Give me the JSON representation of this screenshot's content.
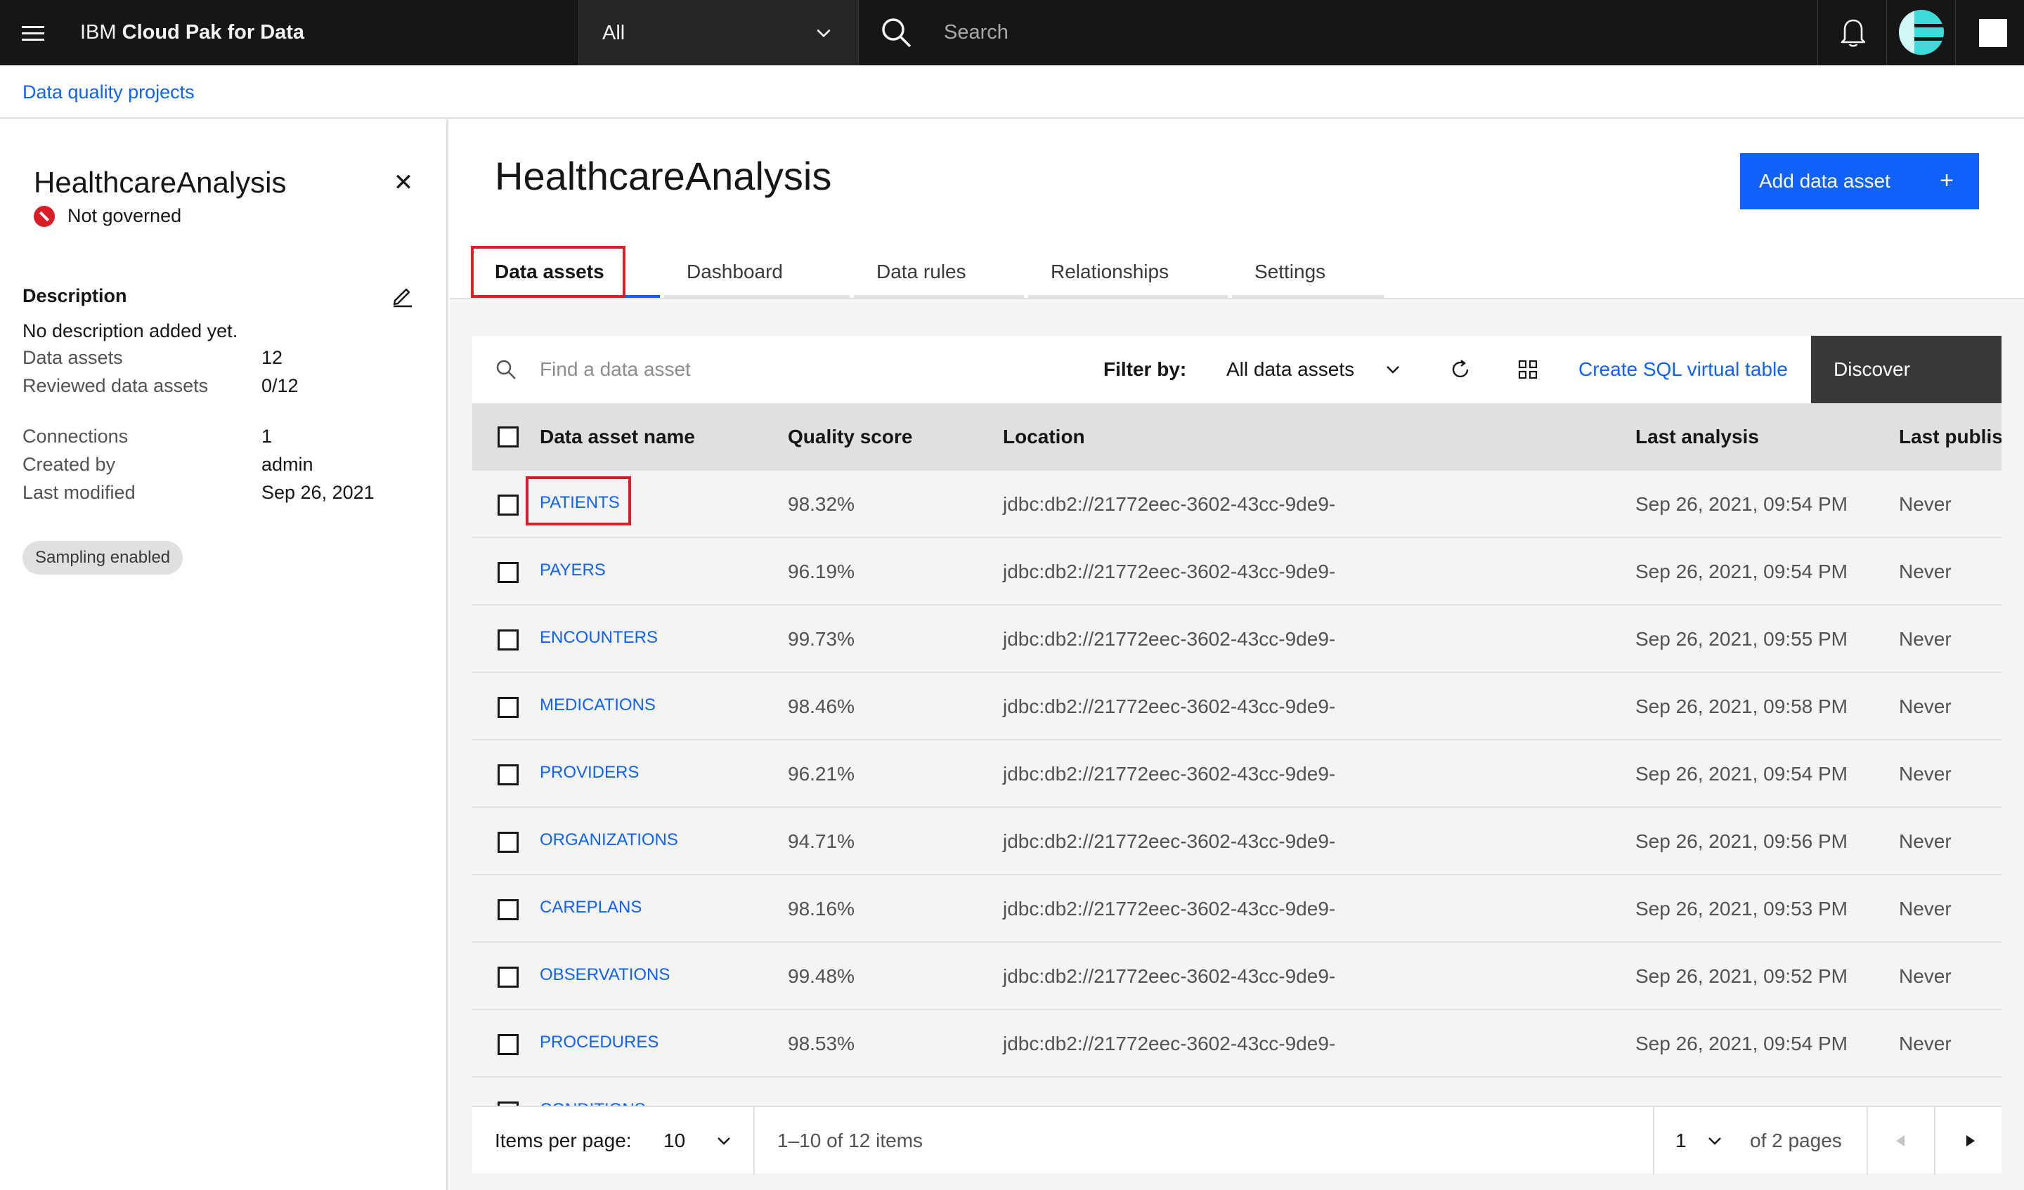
{
  "header": {
    "menu_icon": "hamburger-menu-icon",
    "brand_prefix": "IBM ",
    "brand_name": "Cloud Pak for Data",
    "scope_value": "All",
    "search_placeholder": "Search",
    "notification_icon": "bell-icon",
    "avatar_icon": "user-avatar-icon"
  },
  "breadcrumb": {
    "label": "Data quality projects"
  },
  "side_panel": {
    "title": "HealthcareAnalysis",
    "close_icon": "close-icon",
    "status": "Not governed",
    "description_heading": "Description",
    "description": "No description added yet.",
    "meta": [
      {
        "label": "Data assets",
        "value": "12"
      },
      {
        "label": "Reviewed data assets",
        "value": "0/12"
      },
      {
        "label": "Connections",
        "value": "1"
      },
      {
        "label": "Created by",
        "value": "admin"
      },
      {
        "label": "Last modified",
        "value": "Sep 26, 2021"
      }
    ],
    "tag": "Sampling enabled"
  },
  "main": {
    "title": "HealthcareAnalysis",
    "add_button": "Add data asset",
    "add_icon": "+",
    "tabs": [
      {
        "label": "Data assets",
        "active": true
      },
      {
        "label": "Dashboard",
        "active": false
      },
      {
        "label": "Data rules",
        "active": false
      },
      {
        "label": "Relationships",
        "active": false
      },
      {
        "label": "Settings",
        "active": false
      }
    ]
  },
  "toolbar": {
    "search_placeholder": "Find a data asset",
    "filter_label": "Filter by:",
    "filter_value": "All data assets",
    "create_sql": "Create SQL virtual table",
    "discover": "Discover"
  },
  "table": {
    "columns": [
      "Data asset name",
      "Quality score",
      "Location",
      "Last analysis",
      "Last publisl"
    ],
    "rows": [
      {
        "name": "PATIENTS",
        "score": "98.32%",
        "location": "jdbc:db2://21772eec-3602-43cc-9de9-",
        "last_analysis": "Sep 26, 2021, 09:54 PM",
        "last_published": "Never"
      },
      {
        "name": "PAYERS",
        "score": "96.19%",
        "location": "jdbc:db2://21772eec-3602-43cc-9de9-",
        "last_analysis": "Sep 26, 2021, 09:54 PM",
        "last_published": "Never"
      },
      {
        "name": "ENCOUNTERS",
        "score": "99.73%",
        "location": "jdbc:db2://21772eec-3602-43cc-9de9-",
        "last_analysis": "Sep 26, 2021, 09:55 PM",
        "last_published": "Never"
      },
      {
        "name": "MEDICATIONS",
        "score": "98.46%",
        "location": "jdbc:db2://21772eec-3602-43cc-9de9-",
        "last_analysis": "Sep 26, 2021, 09:58 PM",
        "last_published": "Never"
      },
      {
        "name": "PROVIDERS",
        "score": "96.21%",
        "location": "jdbc:db2://21772eec-3602-43cc-9de9-",
        "last_analysis": "Sep 26, 2021, 09:54 PM",
        "last_published": "Never"
      },
      {
        "name": "ORGANIZATIONS",
        "score": "94.71%",
        "location": "jdbc:db2://21772eec-3602-43cc-9de9-",
        "last_analysis": "Sep 26, 2021, 09:56 PM",
        "last_published": "Never"
      },
      {
        "name": "CAREPLANS",
        "score": "98.16%",
        "location": "jdbc:db2://21772eec-3602-43cc-9de9-",
        "last_analysis": "Sep 26, 2021, 09:53 PM",
        "last_published": "Never"
      },
      {
        "name": "OBSERVATIONS",
        "score": "99.48%",
        "location": "jdbc:db2://21772eec-3602-43cc-9de9-",
        "last_analysis": "Sep 26, 2021, 09:52 PM",
        "last_published": "Never"
      },
      {
        "name": "PROCEDURES",
        "score": "98.53%",
        "location": "jdbc:db2://21772eec-3602-43cc-9de9-",
        "last_analysis": "Sep 26, 2021, 09:54 PM",
        "last_published": "Never"
      },
      {
        "name": "CONDITIONS",
        "score": "",
        "location": "",
        "last_analysis": "",
        "last_published": ""
      }
    ]
  },
  "pagination": {
    "items_per_page_label": "Items per page:",
    "items_per_page": "10",
    "range": "1–10 of 12 items",
    "page": "1",
    "of_pages": "of 2 pages"
  },
  "colors": {
    "accent": "#0f62fe",
    "header_bg": "#161616",
    "highlight": "#da1e28",
    "status_error": "#da1e28"
  }
}
